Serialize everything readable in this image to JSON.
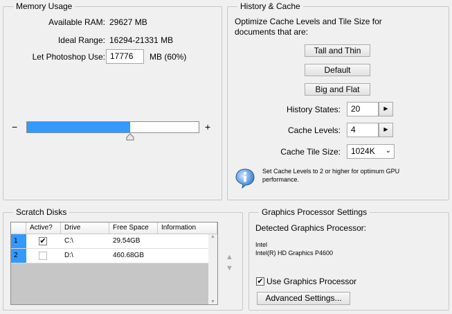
{
  "memory": {
    "title": "Memory Usage",
    "available_label": "Available RAM:",
    "available_value": "29627 MB",
    "ideal_label": "Ideal Range:",
    "ideal_value": "16294-21331 MB",
    "let_label": "Let Photoshop Use:",
    "let_value": "17776",
    "let_suffix": "MB (60%)",
    "slider_fraction": 0.6,
    "minus": "−",
    "plus": "+"
  },
  "history": {
    "title": "History & Cache",
    "description": "Optimize Cache Levels and Tile Size for documents that are:",
    "btn_tall_thin": "Tall and Thin",
    "btn_default": "Default",
    "btn_big_flat": "Big and Flat",
    "states_label": "History States:",
    "states_value": "20",
    "levels_label": "Cache Levels:",
    "levels_value": "4",
    "tile_label": "Cache Tile Size:",
    "tile_value": "1024K",
    "note": "Set Cache Levels to 2 or higher for optimum GPU performance."
  },
  "scratch": {
    "title": "Scratch Disks",
    "columns": [
      "Active?",
      "Drive",
      "Free Space",
      "Information"
    ],
    "rows": [
      {
        "num": "1",
        "active": true,
        "drive": "C:\\",
        "free": "29.54GB",
        "info": ""
      },
      {
        "num": "2",
        "active": false,
        "drive": "D:\\",
        "free": "460.68GB",
        "info": ""
      }
    ]
  },
  "gpu": {
    "title": "Graphics Processor Settings",
    "detected_label": "Detected Graphics Processor:",
    "vendor": "Intel",
    "model": "Intel(R) HD Graphics P4600",
    "use_label": "Use Graphics Processor",
    "use_checked": true,
    "advanced_button": "Advanced Settings..."
  },
  "colors": {
    "accent": "#3399ff",
    "panel": "#f0f0f0"
  }
}
